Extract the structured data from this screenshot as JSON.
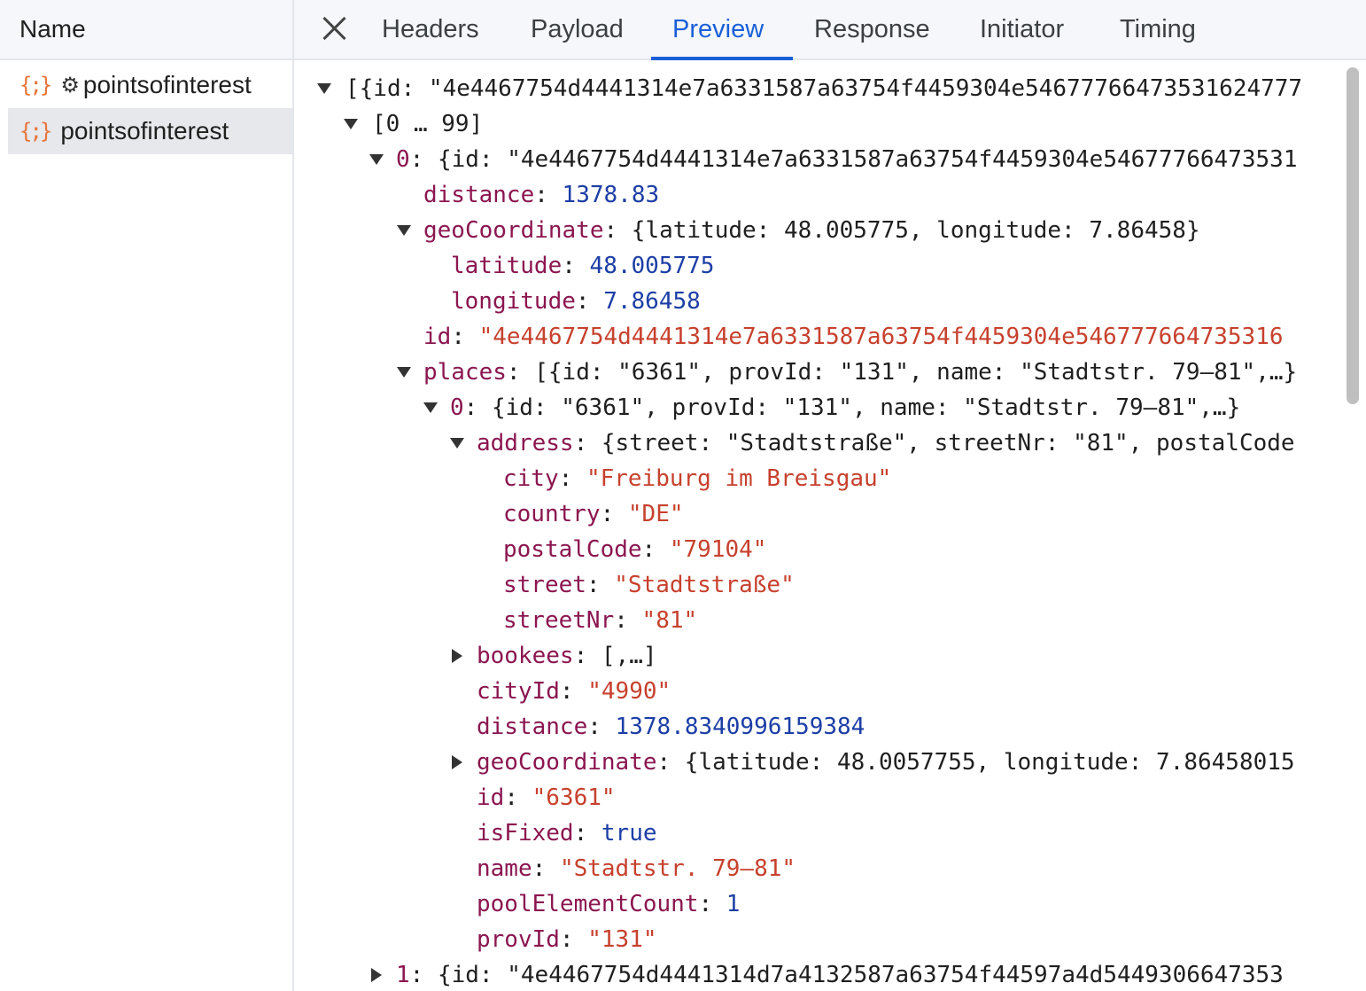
{
  "sidebar": {
    "header": "Name",
    "requests": [
      {
        "icon": "json-icon",
        "gear": true,
        "label": "pointsofinterest"
      },
      {
        "icon": "json-icon",
        "gear": false,
        "label": "pointsofinterest"
      }
    ]
  },
  "tabs": [
    "Headers",
    "Payload",
    "Preview",
    "Response",
    "Initiator",
    "Timing"
  ],
  "active_tab": "Preview",
  "colors": {
    "accent": "#1a5fd8",
    "key": "#8b1650",
    "string": "#c7412e",
    "number": "#1c3ea6"
  },
  "preview": {
    "rows": [
      {
        "toggle": "open",
        "parts": [
          [
            "p",
            "[{id: \"4e4467754d4441314e7a6331587a63754f4459304e54677766473531624777"
          ]
        ]
      },
      {
        "toggle": "open",
        "parts": [
          [
            "p",
            "[0 … 99]"
          ]
        ]
      },
      {
        "toggle": "open",
        "parts": [
          [
            "k",
            "0"
          ],
          [
            "p",
            ": {id: \"4e4467754d4441314e7a6331587a63754f4459304e54677766473531"
          ]
        ]
      },
      {
        "toggle": null,
        "parts": [
          [
            "k",
            "distance"
          ],
          [
            "p",
            ": "
          ],
          [
            "n",
            "1378.83"
          ]
        ]
      },
      {
        "toggle": "open",
        "parts": [
          [
            "k",
            "geoCoordinate"
          ],
          [
            "p",
            ": {latitude: 48.005775, longitude: 7.86458}"
          ]
        ]
      },
      {
        "toggle": null,
        "parts": [
          [
            "k",
            "latitude"
          ],
          [
            "p",
            ": "
          ],
          [
            "n",
            "48.005775"
          ]
        ]
      },
      {
        "toggle": null,
        "parts": [
          [
            "k",
            "longitude"
          ],
          [
            "p",
            ": "
          ],
          [
            "n",
            "7.86458"
          ]
        ]
      },
      {
        "toggle": null,
        "parts": [
          [
            "k",
            "id"
          ],
          [
            "p",
            ": "
          ],
          [
            "s",
            "\"4e4467754d4441314e7a6331587a63754f4459304e546777664735316"
          ]
        ]
      },
      {
        "toggle": "open",
        "parts": [
          [
            "k",
            "places"
          ],
          [
            "p",
            ": [{id: \"6361\", provId: \"131\", name: \"Stadtstr. 79–81\",…}"
          ]
        ]
      },
      {
        "toggle": "open",
        "parts": [
          [
            "k",
            "0"
          ],
          [
            "p",
            ": {id: \"6361\", provId: \"131\", name: \"Stadtstr. 79–81\",…}"
          ]
        ]
      },
      {
        "toggle": "open",
        "parts": [
          [
            "k",
            "address"
          ],
          [
            "p",
            ": {street: \"Stadtstraße\", streetNr: \"81\", postalCode"
          ]
        ]
      },
      {
        "toggle": null,
        "parts": [
          [
            "k",
            "city"
          ],
          [
            "p",
            ": "
          ],
          [
            "s",
            "\"Freiburg im Breisgau\""
          ]
        ]
      },
      {
        "toggle": null,
        "parts": [
          [
            "k",
            "country"
          ],
          [
            "p",
            ": "
          ],
          [
            "s",
            "\"DE\""
          ]
        ]
      },
      {
        "toggle": null,
        "parts": [
          [
            "k",
            "postalCode"
          ],
          [
            "p",
            ": "
          ],
          [
            "s",
            "\"79104\""
          ]
        ]
      },
      {
        "toggle": null,
        "parts": [
          [
            "k",
            "street"
          ],
          [
            "p",
            ": "
          ],
          [
            "s",
            "\"Stadtstraße\""
          ]
        ]
      },
      {
        "toggle": null,
        "parts": [
          [
            "k",
            "streetNr"
          ],
          [
            "p",
            ": "
          ],
          [
            "s",
            "\"81\""
          ]
        ]
      },
      {
        "toggle": "closed",
        "parts": [
          [
            "k",
            "bookees"
          ],
          [
            "p",
            ": [,…]"
          ]
        ]
      },
      {
        "toggle": null,
        "parts": [
          [
            "k",
            "cityId"
          ],
          [
            "p",
            ": "
          ],
          [
            "s",
            "\"4990\""
          ]
        ]
      },
      {
        "toggle": null,
        "parts": [
          [
            "k",
            "distance"
          ],
          [
            "p",
            ": "
          ],
          [
            "n",
            "1378.8340996159384"
          ]
        ]
      },
      {
        "toggle": "closed",
        "parts": [
          [
            "k",
            "geoCoordinate"
          ],
          [
            "p",
            ": {latitude: 48.0057755, longitude: 7.86458015"
          ]
        ]
      },
      {
        "toggle": null,
        "parts": [
          [
            "k",
            "id"
          ],
          [
            "p",
            ": "
          ],
          [
            "s",
            "\"6361\""
          ]
        ]
      },
      {
        "toggle": null,
        "parts": [
          [
            "k",
            "isFixed"
          ],
          [
            "p",
            ": "
          ],
          [
            "n",
            "true"
          ]
        ]
      },
      {
        "toggle": null,
        "parts": [
          [
            "k",
            "name"
          ],
          [
            "p",
            ": "
          ],
          [
            "s",
            "\"Stadtstr. 79–81\""
          ]
        ]
      },
      {
        "toggle": null,
        "parts": [
          [
            "k",
            "poolElementCount"
          ],
          [
            "p",
            ": "
          ],
          [
            "n",
            "1"
          ]
        ]
      },
      {
        "toggle": null,
        "parts": [
          [
            "k",
            "provId"
          ],
          [
            "p",
            ": "
          ],
          [
            "s",
            "\"131\""
          ]
        ]
      },
      {
        "toggle": "closed",
        "parts": [
          [
            "k",
            "1"
          ],
          [
            "p",
            ": {id: \"4e4467754d4441314d7a4132587a63754f44597a4d5449306647353"
          ]
        ]
      }
    ]
  }
}
